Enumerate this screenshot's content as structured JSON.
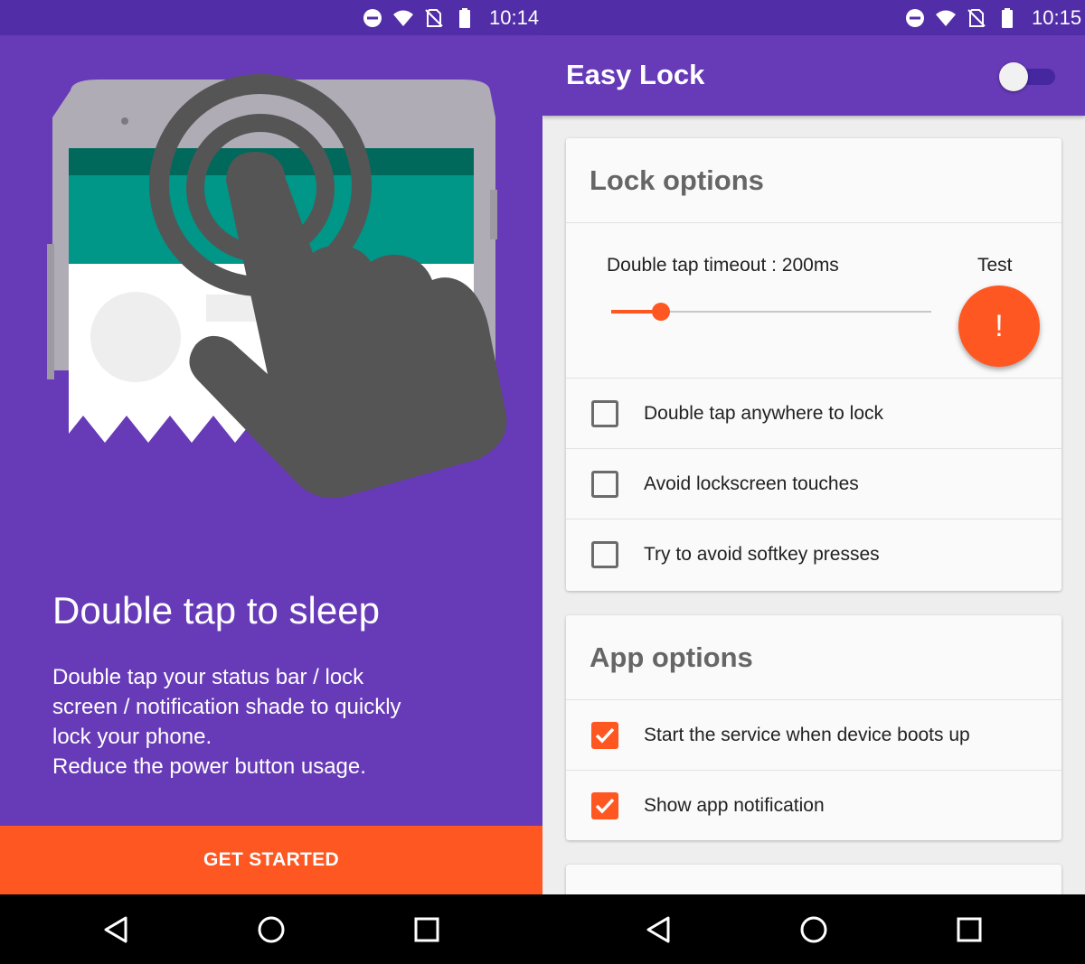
{
  "left": {
    "statusbar": {
      "time": "10:14"
    },
    "intro": {
      "title": "Double tap to sleep",
      "desc_lines": [
        "Double tap your status bar / lock",
        "screen / notification shade to quickly",
        "lock your phone.",
        "Reduce the power button usage."
      ]
    },
    "get_started_label": "GET STARTED"
  },
  "right": {
    "statusbar": {
      "time": "10:15"
    },
    "appbar": {
      "title": "Easy Lock",
      "switch_on": false
    },
    "lock_card": {
      "title": "Lock options",
      "timeout_label": "Double tap timeout : 200ms",
      "slider_level": 0.155,
      "test_label": "Test",
      "test_button_label": "!",
      "options": [
        {
          "label": "Double tap anywhere to lock",
          "checked": false
        },
        {
          "label": "Avoid lockscreen touches",
          "checked": false
        },
        {
          "label": "Try to avoid softkey presses",
          "checked": false
        }
      ]
    },
    "app_card": {
      "title": "App options",
      "options": [
        {
          "label": "Start the service when device boots up",
          "checked": true
        },
        {
          "label": "Show app notification",
          "checked": true
        }
      ]
    }
  },
  "icons": {
    "statusbar": [
      "do-not-disturb-icon",
      "wifi-icon",
      "no-sim-icon",
      "battery-icon"
    ],
    "navbar": [
      "back-icon",
      "home-icon",
      "recents-icon"
    ]
  },
  "colors": {
    "primary": "#673ab7",
    "primary_dark": "#512da8",
    "accent": "#ff5722",
    "card_bg": "#fafafa",
    "screen_bg": "#eeeeee"
  }
}
